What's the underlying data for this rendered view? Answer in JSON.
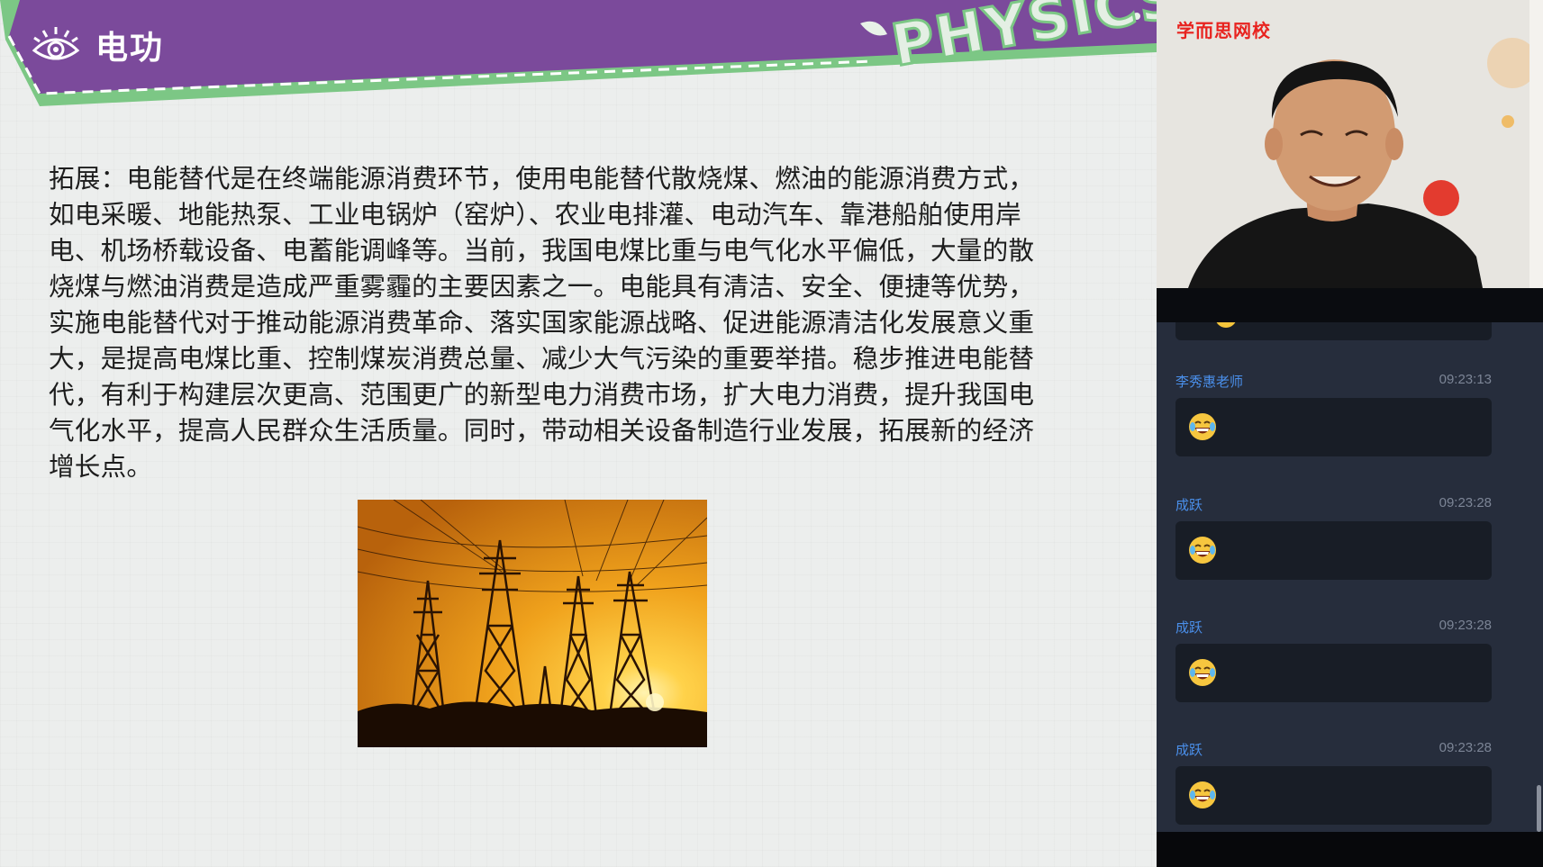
{
  "slide": {
    "title": "电功",
    "decor_word": "PHYSICS",
    "body": "拓展：电能替代是在终端能源消费环节，使用电能替代散烧煤、燃油的能源消费方式，如电采暖、地能热泵、工业电锅炉（窑炉）、农业电排灌、电动汽车、靠港船舶使用岸电、机场桥载设备、电蓄能调峰等。当前，我国电煤比重与电气化水平偏低，大量的散烧煤与燃油消费是造成严重雾霾的主要因素之一。电能具有清洁、安全、便捷等优势，实施电能替代对于推动能源消费革命、落实国家能源战略、促进能源清洁化发展意义重大，是提高电煤比重、控制煤炭消费总量、减少大气污染的重要举措。稳步推进电能替代，有利于构建层次更高、范围更广的新型电力消费市场，扩大电力消费，提升我国电气化水平，提高人民群众生活质量。同时，带动相关设备制造行业发展，拓展新的经济增长点。",
    "colors": {
      "banner": "#7b4a9b",
      "accent_green": "#7cc785"
    }
  },
  "video": {
    "brand": "学而思网校"
  },
  "chat": {
    "messages": [
      {
        "user": "李秀惠老师",
        "time": "09:23:13",
        "emoji": "laughing-tears"
      },
      {
        "user": "成跃",
        "time": "09:23:28",
        "emoji": "laughing-tears"
      },
      {
        "user": "成跃",
        "time": "09:23:28",
        "emoji": "laughing-tears"
      },
      {
        "user": "成跃",
        "time": "09:23:28",
        "emoji": "laughing-tears"
      }
    ]
  }
}
